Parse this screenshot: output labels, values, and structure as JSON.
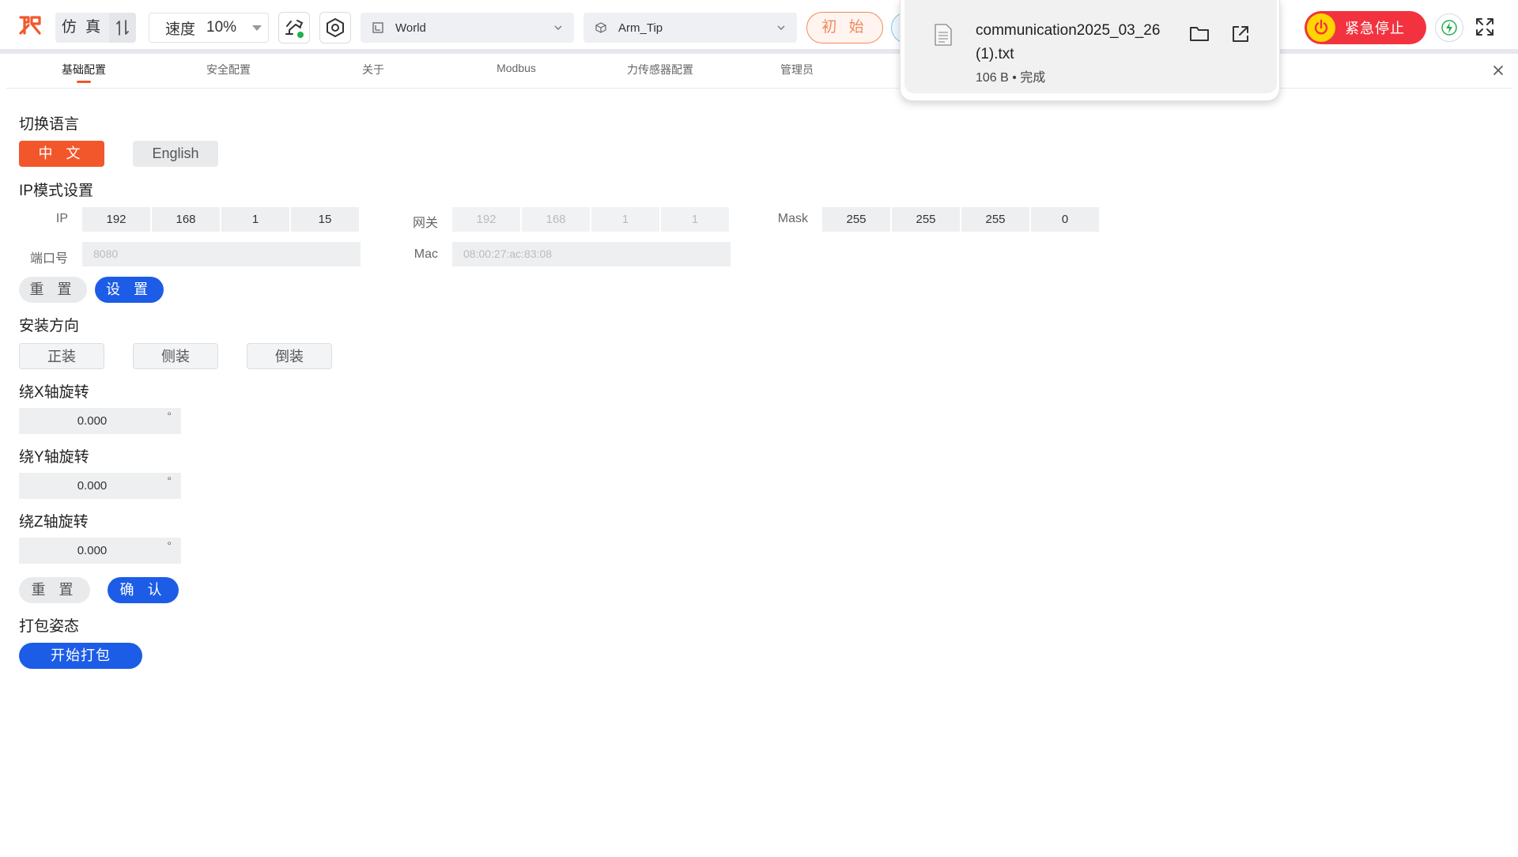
{
  "toolbar": {
    "mode_label": "仿 真",
    "speed_label": "速度",
    "speed_value": "10%",
    "frame_select": "World",
    "tool_select": "Arm_Tip",
    "init_label": "初 始",
    "estop_label": "紧急停止",
    "colors": {
      "accent": "#f2572c",
      "primary": "#1c5ce7",
      "estop": "#f2333f",
      "estop_icon": "#ffd500"
    }
  },
  "download": {
    "file_name_line1": "communication2025_03_26",
    "file_name_line2": "(1).txt",
    "status": "106 B • 完成"
  },
  "tabs": [
    {
      "label": "基础配置",
      "active": true
    },
    {
      "label": "安全配置",
      "active": false
    },
    {
      "label": "关于",
      "active": false
    },
    {
      "label": "Modbus",
      "active": false
    },
    {
      "label": "力传感器配置",
      "active": false
    },
    {
      "label": "管理员",
      "active": false
    }
  ],
  "language": {
    "title": "切换语言",
    "zh_label": "中 文",
    "en_label": "English"
  },
  "ip": {
    "title": "IP模式设置",
    "ip_label": "IP",
    "ip_values": [
      "192",
      "168",
      "1",
      "15"
    ],
    "gateway_label": "网关",
    "gateway_values": [
      "192",
      "168",
      "1",
      "1"
    ],
    "mask_label": "Mask",
    "mask_values": [
      "255",
      "255",
      "255",
      "0"
    ],
    "port_label": "端口号",
    "port_placeholder": "8080",
    "mac_label": "Mac",
    "mac_placeholder": "08:00:27:ac:83:08",
    "reset_label": "重 置",
    "set_label": "设 置"
  },
  "mount": {
    "title": "安装方向",
    "options": [
      "正装",
      "侧装",
      "倒装"
    ]
  },
  "rotation": {
    "x_title": "绕X轴旋转",
    "x_value": "0.000",
    "y_title": "绕Y轴旋转",
    "y_value": "0.000",
    "z_title": "绕Z轴旋转",
    "z_value": "0.000",
    "unit": "°",
    "reset_label": "重 置",
    "confirm_label": "确 认"
  },
  "pack": {
    "title": "打包姿态",
    "start_label": "开始打包"
  }
}
